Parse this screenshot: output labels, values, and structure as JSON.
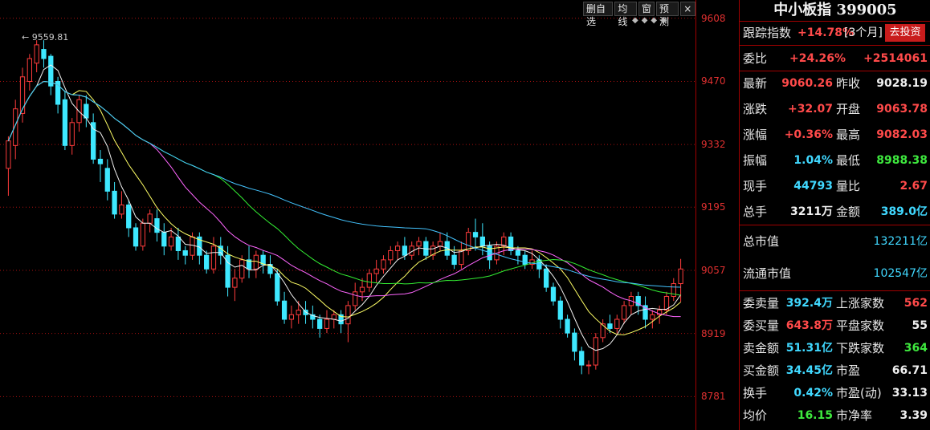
{
  "toolbar": {
    "delete_label": "删自选",
    "ma_label": "均线",
    "window_label": "窗",
    "forecast_label": "预测",
    "close_label": "×"
  },
  "panel": {
    "title": "中小板指 399005",
    "track": {
      "label": "跟踪指数",
      "value": "+14.78%",
      "period": "[3个月]",
      "button": "去投资"
    },
    "weibi": {
      "label": "委比",
      "pct": "+24.26%",
      "amount": "+2514061"
    },
    "quote": [
      {
        "l1": "最新",
        "v1": "9060.26",
        "c1": "red",
        "l2": "昨收",
        "v2": "9028.19",
        "c2": "white"
      },
      {
        "l1": "涨跌",
        "v1": "+32.07",
        "c1": "red",
        "l2": "开盘",
        "v2": "9063.78",
        "c2": "red"
      },
      {
        "l1": "涨幅",
        "v1": "+0.36%",
        "c1": "red",
        "l2": "最高",
        "v2": "9082.03",
        "c2": "red"
      },
      {
        "l1": "振幅",
        "v1": "1.04%",
        "c1": "cyan",
        "l2": "最低",
        "v2": "8988.38",
        "c2": "green"
      },
      {
        "l1": "现手",
        "v1": "44793",
        "c1": "cyan",
        "l2": "量比",
        "v2": "2.67",
        "c2": "red"
      },
      {
        "l1": "总手",
        "v1": "3211万",
        "c1": "white",
        "l2": "金额",
        "v2": "389.0亿",
        "c2": "cyan"
      }
    ],
    "total_cap": {
      "label": "总市值",
      "value": "132211亿"
    },
    "float_cap": {
      "label": "流通市值",
      "value": "102547亿"
    },
    "stats": [
      {
        "l1": "委卖量",
        "v1": "392.4万",
        "c1": "cyan",
        "l2": "上涨家数",
        "v2": "562",
        "c2": "red"
      },
      {
        "l1": "委买量",
        "v1": "643.8万",
        "c1": "red",
        "l2": "平盘家数",
        "v2": "55",
        "c2": "white"
      },
      {
        "l1": "卖金额",
        "v1": "51.31亿",
        "c1": "cyan",
        "l2": "下跌家数",
        "v2": "364",
        "c2": "green"
      },
      {
        "l1": "买金额",
        "v1": "34.45亿",
        "c1": "cyan",
        "l2": "市盈",
        "v2": "66.71",
        "c2": "white"
      },
      {
        "l1": "换手",
        "v1": "0.42%",
        "c1": "cyan",
        "l2": "市盈(动)",
        "v2": "33.13",
        "c2": "white"
      },
      {
        "l1": "均价",
        "v1": "16.15",
        "c1": "green",
        "l2": "市净率",
        "v2": "3.39",
        "c2": "white"
      }
    ]
  },
  "chart_data": {
    "type": "candlestick",
    "yticks": [
      "9608",
      "9470",
      "9332",
      "9195",
      "9057",
      "8919",
      "8781"
    ],
    "ylim": [
      8708,
      9648
    ],
    "max_label": "9559.81",
    "colors": {
      "up": "#ff3c3c",
      "down": "#3ee8ff",
      "ma5": "#f0f0f0",
      "ma10": "#ffff66",
      "ma20": "#ff66ff",
      "ma30": "#33ee33",
      "ma60": "#44c4ff",
      "grid": "#aa1111"
    },
    "candles": [
      [
        9280,
        9340,
        9220,
        9350
      ],
      [
        9330,
        9410,
        9300,
        9430
      ],
      [
        9400,
        9480,
        9380,
        9500
      ],
      [
        9470,
        9520,
        9450,
        9530
      ],
      [
        9510,
        9550,
        9490,
        9560
      ],
      [
        9540,
        9520,
        9500,
        9560
      ],
      [
        9525,
        9460,
        9440,
        9530
      ],
      [
        9470,
        9420,
        9400,
        9480
      ],
      [
        9430,
        9330,
        9320,
        9450
      ],
      [
        9330,
        9380,
        9310,
        9390
      ],
      [
        9380,
        9430,
        9360,
        9440
      ],
      [
        9420,
        9390,
        9370,
        9440
      ],
      [
        9380,
        9300,
        9290,
        9400
      ],
      [
        9300,
        9290,
        9250,
        9320
      ],
      [
        9280,
        9230,
        9210,
        9300
      ],
      [
        9230,
        9180,
        9170,
        9250
      ],
      [
        9180,
        9200,
        9170,
        9230
      ],
      [
        9200,
        9150,
        9130,
        9210
      ],
      [
        9150,
        9110,
        9100,
        9160
      ],
      [
        9110,
        9160,
        9100,
        9170
      ],
      [
        9160,
        9180,
        9140,
        9190
      ],
      [
        9170,
        9140,
        9120,
        9190
      ],
      [
        9140,
        9110,
        9090,
        9160
      ],
      [
        9110,
        9130,
        9100,
        9150
      ],
      [
        9130,
        9100,
        9080,
        9150
      ],
      [
        9100,
        9090,
        9070,
        9110
      ],
      [
        9090,
        9130,
        9080,
        9140
      ],
      [
        9130,
        9090,
        9070,
        9140
      ],
      [
        9090,
        9060,
        9050,
        9100
      ],
      [
        9060,
        9110,
        9050,
        9130
      ],
      [
        9110,
        9090,
        9070,
        9130
      ],
      [
        9090,
        9020,
        9000,
        9110
      ],
      [
        9020,
        9040,
        8990,
        9060
      ],
      [
        9040,
        9080,
        9030,
        9090
      ],
      [
        9080,
        9060,
        9040,
        9110
      ],
      [
        9060,
        9090,
        9040,
        9100
      ],
      [
        9090,
        9070,
        9050,
        9100
      ],
      [
        9070,
        9050,
        9040,
        9090
      ],
      [
        9050,
        8990,
        8980,
        9060
      ],
      [
        8990,
        8950,
        8940,
        9010
      ],
      [
        8950,
        8960,
        8930,
        8980
      ],
      [
        8960,
        8970,
        8940,
        8990
      ],
      [
        8970,
        8960,
        8940,
        8990
      ],
      [
        8960,
        8950,
        8930,
        8980
      ],
      [
        8950,
        8930,
        8910,
        8960
      ],
      [
        8930,
        8950,
        8920,
        8970
      ],
      [
        8950,
        8960,
        8930,
        8970
      ],
      [
        8960,
        8940,
        8920,
        8970
      ],
      [
        8940,
        8980,
        8900,
        8990
      ],
      [
        8980,
        9010,
        8970,
        9030
      ],
      [
        9010,
        9020,
        8990,
        9040
      ],
      [
        9020,
        9050,
        9010,
        9060
      ],
      [
        9050,
        9060,
        9030,
        9080
      ],
      [
        9060,
        9080,
        9050,
        9090
      ],
      [
        9080,
        9100,
        9070,
        9110
      ],
      [
        9100,
        9110,
        9080,
        9120
      ],
      [
        9110,
        9090,
        9080,
        9130
      ],
      [
        9090,
        9110,
        9080,
        9120
      ],
      [
        9110,
        9120,
        9090,
        9130
      ],
      [
        9120,
        9090,
        9080,
        9130
      ],
      [
        9090,
        9110,
        9080,
        9120
      ],
      [
        9110,
        9120,
        9100,
        9140
      ],
      [
        9120,
        9090,
        9080,
        9140
      ],
      [
        9090,
        9070,
        9060,
        9110
      ],
      [
        9070,
        9100,
        9060,
        9120
      ],
      [
        9100,
        9140,
        9090,
        9150
      ],
      [
        9140,
        9130,
        9100,
        9170
      ],
      [
        9130,
        9110,
        9090,
        9160
      ],
      [
        9110,
        9080,
        9060,
        9120
      ],
      [
        9080,
        9110,
        9070,
        9120
      ],
      [
        9110,
        9130,
        9090,
        9140
      ],
      [
        9130,
        9100,
        9090,
        9140
      ],
      [
        9100,
        9090,
        9070,
        9110
      ],
      [
        9090,
        9070,
        9060,
        9100
      ],
      [
        9070,
        9080,
        9060,
        9100
      ],
      [
        9080,
        9060,
        9040,
        9090
      ],
      [
        9060,
        9020,
        9010,
        9070
      ],
      [
        9020,
        8990,
        8980,
        9030
      ],
      [
        8990,
        8950,
        8930,
        9000
      ],
      [
        8950,
        8920,
        8910,
        8960
      ],
      [
        8920,
        8880,
        8860,
        8930
      ],
      [
        8880,
        8850,
        8830,
        8890
      ],
      [
        8850,
        8850,
        8830,
        8860
      ],
      [
        8850,
        8910,
        8840,
        8920
      ],
      [
        8910,
        8940,
        8900,
        8950
      ],
      [
        8940,
        8930,
        8920,
        8960
      ],
      [
        8930,
        8950,
        8920,
        8960
      ],
      [
        8950,
        8980,
        8940,
        8990
      ],
      [
        8980,
        9000,
        8960,
        9010
      ],
      [
        9000,
        8980,
        8960,
        9010
      ],
      [
        8980,
        8950,
        8930,
        9000
      ],
      [
        8950,
        8960,
        8930,
        8970
      ],
      [
        8960,
        8970,
        8940,
        8980
      ],
      [
        8970,
        9000,
        8960,
        9010
      ],
      [
        9000,
        9028,
        8990,
        9040
      ],
      [
        9028,
        9060,
        8988,
        9082
      ]
    ]
  }
}
